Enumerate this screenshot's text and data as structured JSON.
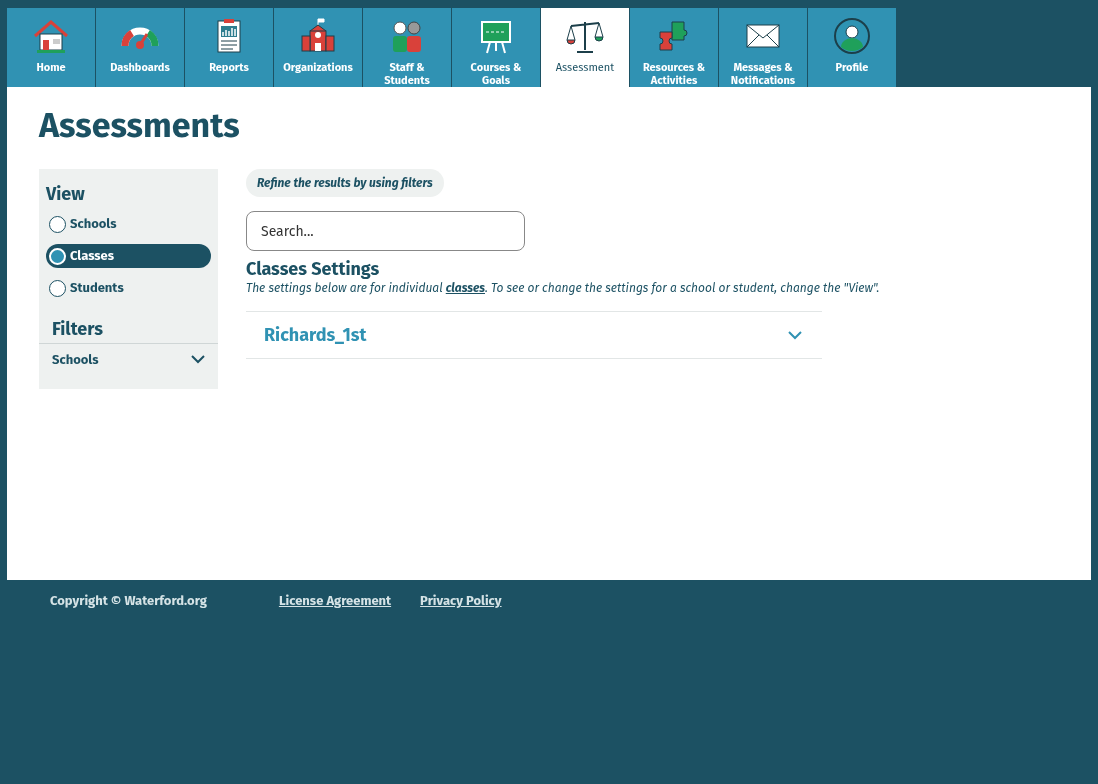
{
  "nav": [
    {
      "label": "Home",
      "kind": "home",
      "selected": false
    },
    {
      "label": "Dashboards",
      "kind": "gauge",
      "selected": false
    },
    {
      "label": "Reports",
      "kind": "report",
      "selected": false
    },
    {
      "label": "Organizations",
      "kind": "school",
      "selected": false
    },
    {
      "label": "Staff & Students",
      "kind": "people",
      "selected": false
    },
    {
      "label": "Courses & Goals",
      "kind": "board",
      "selected": false
    },
    {
      "label": "Assessment",
      "kind": "scale",
      "selected": true
    },
    {
      "label": "Resources & Activities",
      "kind": "puzzle",
      "selected": false
    },
    {
      "label": "Messages & Notifications",
      "kind": "mail",
      "selected": false
    },
    {
      "label": "Profile",
      "kind": "person",
      "selected": false
    }
  ],
  "page_title": "Assessments",
  "sidebar": {
    "view_heading": "View",
    "views": [
      {
        "label": "Schools",
        "selected": false
      },
      {
        "label": "Classes",
        "selected": true
      },
      {
        "label": "Students",
        "selected": false
      }
    ],
    "filters_heading": "Filters",
    "filters": [
      {
        "label": "Schools",
        "expanded": false
      }
    ]
  },
  "hint": "Refine the results by using filters",
  "search": {
    "placeholder": "Search..."
  },
  "settings": {
    "title": "Classes Settings",
    "description_before": "The settings below are for individual ",
    "description_link": "classes",
    "description_after": ". To see or change the settings for a school or student, change the \"View\".",
    "items": [
      {
        "label": "Richards_1st",
        "expanded": false
      }
    ]
  },
  "footer": {
    "copyright": "Copyright © Waterford.org",
    "links": [
      "License Agreement",
      "Privacy Policy"
    ]
  }
}
